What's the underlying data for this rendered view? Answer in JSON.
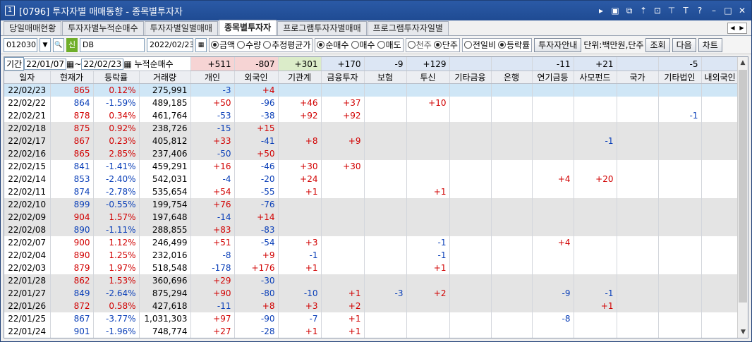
{
  "titlebar": {
    "num": "1",
    "title": "[0796] 투자자별 매매동향 - 종목별투자자"
  },
  "tabs": [
    {
      "label": "당일매매현황"
    },
    {
      "label": "투자자별누적순매수"
    },
    {
      "label": "투자자별일별매매"
    },
    {
      "label": "종목별투자자"
    },
    {
      "label": "프로그램투자자별매매"
    },
    {
      "label": "프로그램투자자일별"
    }
  ],
  "toolbar": {
    "code": "012030",
    "shin": "신",
    "name": "DB",
    "date": "2022/02/23",
    "amount": "금액",
    "qty": "수량",
    "est_avg": "추정평균가",
    "net_buy": "순매수",
    "buy": "매수",
    "sell": "매도",
    "thousand": "천주",
    "unit_share": "단주",
    "prev": "전일비",
    "rate": "등락률",
    "guide": "투자자안내",
    "unit": "단위:백만원,단주",
    "query": "조회",
    "next": "다음",
    "chart": "차트"
  },
  "period": {
    "label": "기간",
    "from": "22/01/07",
    "tilde": "~",
    "to": "22/02/23",
    "cum_label": "누적순매수"
  },
  "headers": [
    "일자",
    "현재가",
    "등락률",
    "거래량",
    "개인",
    "외국인",
    "기관계",
    "금융투자",
    "보험",
    "투신",
    "기타금융",
    "은행",
    "연기금등",
    "사모펀드",
    "국가",
    "기타법인",
    "내외국인"
  ],
  "totals": {
    "개인": "+511",
    "외국인": "-807",
    "기관계": "+301",
    "금융투자": "+170",
    "보험": "-9",
    "투신": "+129",
    "기타금융": "",
    "은행": "",
    "연기금등": "-11",
    "사모펀드": "+21",
    "국가": "",
    "기타법인": "-5",
    "내외국인": ""
  },
  "rows": [
    [
      "22/02/23",
      "865",
      "0.12%",
      "275,991",
      "-3",
      "+4",
      "",
      "",
      "",
      "",
      "",
      "",
      "",
      "",
      "",
      "",
      ""
    ],
    [
      "22/02/22",
      "864",
      "-1.59%",
      "489,185",
      "+50",
      "-96",
      "+46",
      "+37",
      "",
      "+10",
      "",
      "",
      "",
      "",
      "",
      "",
      ""
    ],
    [
      "22/02/21",
      "878",
      "0.34%",
      "461,764",
      "-53",
      "-38",
      "+92",
      "+92",
      "",
      "",
      "",
      "",
      "",
      "",
      "",
      "-1",
      ""
    ],
    [
      "22/02/18",
      "875",
      "0.92%",
      "238,726",
      "-15",
      "+15",
      "",
      "",
      "",
      "",
      "",
      "",
      "",
      "",
      "",
      "",
      ""
    ],
    [
      "22/02/17",
      "867",
      "0.23%",
      "405,812",
      "+33",
      "-41",
      "+8",
      "+9",
      "",
      "",
      "",
      "",
      "",
      "-1",
      "",
      "",
      ""
    ],
    [
      "22/02/16",
      "865",
      "2.85%",
      "237,406",
      "-50",
      "+50",
      "",
      "",
      "",
      "",
      "",
      "",
      "",
      "",
      "",
      "",
      ""
    ],
    [
      "22/02/15",
      "841",
      "-1.41%",
      "459,291",
      "+16",
      "-46",
      "+30",
      "+30",
      "",
      "",
      "",
      "",
      "",
      "",
      "",
      "",
      ""
    ],
    [
      "22/02/14",
      "853",
      "-2.40%",
      "542,031",
      "-4",
      "-20",
      "+24",
      "",
      "",
      "",
      "",
      "",
      "+4",
      "+20",
      "",
      "",
      ""
    ],
    [
      "22/02/11",
      "874",
      "-2.78%",
      "535,654",
      "+54",
      "-55",
      "+1",
      "",
      "",
      "+1",
      "",
      "",
      "",
      "",
      "",
      "",
      ""
    ],
    [
      "22/02/10",
      "899",
      "-0.55%",
      "199,754",
      "+76",
      "-76",
      "",
      "",
      "",
      "",
      "",
      "",
      "",
      "",
      "",
      "",
      ""
    ],
    [
      "22/02/09",
      "904",
      "1.57%",
      "197,648",
      "-14",
      "+14",
      "",
      "",
      "",
      "",
      "",
      "",
      "",
      "",
      "",
      "",
      ""
    ],
    [
      "22/02/08",
      "890",
      "-1.11%",
      "288,855",
      "+83",
      "-83",
      "",
      "",
      "",
      "",
      "",
      "",
      "",
      "",
      "",
      "",
      ""
    ],
    [
      "22/02/07",
      "900",
      "1.12%",
      "246,499",
      "+51",
      "-54",
      "+3",
      "",
      "",
      "-1",
      "",
      "",
      "+4",
      "",
      "",
      "",
      ""
    ],
    [
      "22/02/04",
      "890",
      "1.25%",
      "232,016",
      "-8",
      "+9",
      "-1",
      "",
      "",
      "-1",
      "",
      "",
      "",
      "",
      "",
      "",
      ""
    ],
    [
      "22/02/03",
      "879",
      "1.97%",
      "518,548",
      "-178",
      "+176",
      "+1",
      "",
      "",
      "+1",
      "",
      "",
      "",
      "",
      "",
      "",
      ""
    ],
    [
      "22/01/28",
      "862",
      "1.53%",
      "360,696",
      "+29",
      "-30",
      "",
      "",
      "",
      "",
      "",
      "",
      "",
      "",
      "",
      "",
      ""
    ],
    [
      "22/01/27",
      "849",
      "-2.64%",
      "875,294",
      "+90",
      "-80",
      "-10",
      "+1",
      "-3",
      "+2",
      "",
      "",
      "-9",
      "-1",
      "",
      "",
      ""
    ],
    [
      "22/01/26",
      "872",
      "0.58%",
      "427,618",
      "-11",
      "+8",
      "+3",
      "+2",
      "",
      "",
      "",
      "",
      "",
      "+1",
      "",
      "",
      ""
    ],
    [
      "22/01/25",
      "867",
      "-3.77%",
      "1,031,303",
      "+97",
      "-90",
      "-7",
      "+1",
      "",
      "",
      "",
      "",
      "-8",
      "",
      "",
      "",
      ""
    ],
    [
      "22/01/24",
      "901",
      "-1.96%",
      "748,774",
      "+27",
      "-28",
      "+1",
      "+1",
      "",
      "",
      "",
      "",
      "",
      "",
      "",
      "",
      ""
    ]
  ],
  "row_shading": [
    "sel",
    "white",
    "white",
    "gray",
    "gray",
    "gray",
    "white",
    "white",
    "white",
    "gray",
    "gray",
    "gray",
    "white",
    "white",
    "white",
    "gray",
    "gray",
    "gray",
    "white",
    "white"
  ],
  "colors": {
    "up": "#d10000",
    "down": "#0a3fb8",
    "title_bg": "#1f4b93",
    "total_pos_red": "#f6d4d4",
    "total_green": "#dbecc9",
    "total_blue": "#dce6f4"
  },
  "icons": [
    "arrow-right-icon",
    "window-icon",
    "restore-icon",
    "pin-icon",
    "link-icon",
    "pushpin-icon",
    "font-icon",
    "help-icon",
    "minimize-icon",
    "maximize-icon",
    "close-icon"
  ]
}
